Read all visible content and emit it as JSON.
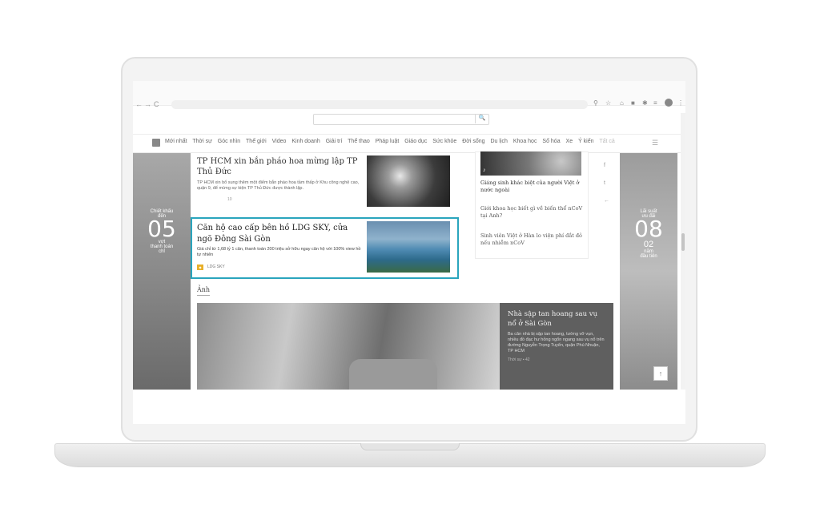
{
  "browser": {
    "nav": [
      "←",
      "→",
      "C"
    ],
    "toolbar_icons": [
      "search-icon",
      "star-icon",
      "extension-icon",
      "puzzle-icon",
      "pin-icon",
      "playlist-icon",
      "avatar"
    ]
  },
  "search": {
    "button": "🔍"
  },
  "menu": {
    "items": [
      "Mới nhất",
      "Thời sự",
      "Góc nhìn",
      "Thế giới",
      "Video",
      "Kinh doanh",
      "Giải trí",
      "Thể thao",
      "Pháp luật",
      "Giáo dục",
      "Sức khỏe",
      "Đời sống",
      "Du lịch",
      "Khoa học",
      "Số hóa",
      "Xe",
      "Ý kiến",
      "Tất cả"
    ]
  },
  "banner_left": {
    "line1": "Chiết khấu",
    "line2": "đến",
    "number": "05",
    "line3": "vợt",
    "line4": "thanh toán",
    "line5": "chỉ"
  },
  "banner_right": {
    "line1": "Lãi suất",
    "line2": "ưu đãi",
    "number": "08",
    "line3": "02",
    "line4": "năm",
    "line5": "đầu tiên"
  },
  "article1": {
    "title": "TP HCM xin bắn pháo hoa mừng lập TP Thủ Đức",
    "desc": "TP HCM xin bổ sung thêm một điểm bắn pháo hoa tầm thấp ở Khu công nghệ cao, quận 9, để mừng sự kiện TP Thủ Đức được thành lập.",
    "count": "10"
  },
  "ad": {
    "title": "Căn hộ cao cấp bên hồ LDG SKY, cửa ngõ Đông Sài Gòn",
    "desc": "Giá chỉ từ 1,68 tỷ 1 căn, thanh toán 200 triệu sở hữu ngay căn hộ với 100% view hồ tự nhiên",
    "brand": "LDG SKY"
  },
  "right_col": {
    "links": [
      "Giáng sinh khác biệt của người Việt ở nước ngoài",
      "Giới khoa học biết gì về biến thể nCoV tại Anh?",
      "Sinh viên Việt ở Hàn lo viện phí đắt đỏ nếu nhiễm nCoV"
    ]
  },
  "social": [
    "f",
    "t",
    "←"
  ],
  "section": {
    "label": "Ảnh"
  },
  "photo_caption": {
    "title": "Nhà sập tan hoang sau vụ nổ ở Sài Gòn",
    "desc": "Ba căn nhà bị sập tan hoang, tường vỡ vụn, nhiều đồ đạc hư hỏng ngổn ngang sau vụ nổ trên đường Nguyễn Trọng Tuyển, quận Phú Nhuận, TP HCM",
    "meta": "Thời sự",
    "count": "42"
  },
  "scroll_top": "↑"
}
